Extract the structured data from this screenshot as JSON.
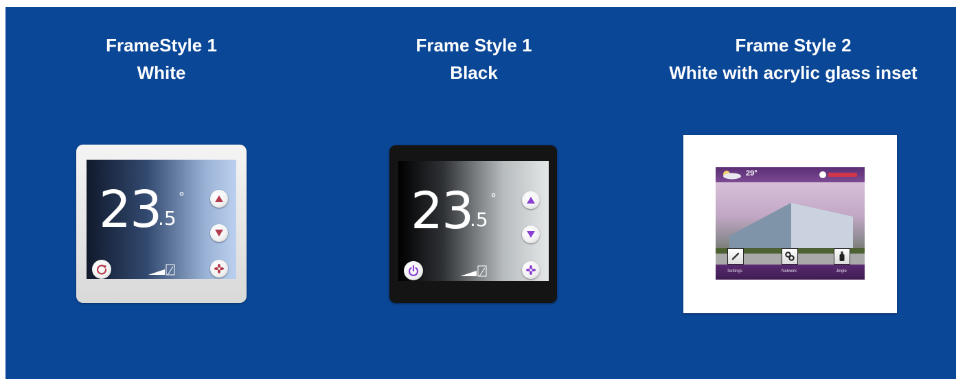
{
  "captions": [
    {
      "line1": "FrameStyle 1",
      "line2": "White"
    },
    {
      "line1": "Frame Style 1",
      "line2": "Black"
    },
    {
      "line1": "Frame Style 2",
      "line2": "White with acrylic glass inset"
    }
  ],
  "devices": [
    {
      "temp_int": "23",
      "temp_dec": ".5",
      "deg": "°"
    },
    {
      "temp_int": "23",
      "temp_dec": ".5",
      "deg": "°"
    },
    {
      "weather_temp": "29°",
      "tiles": [
        "Settings",
        "Network",
        "Jingle"
      ]
    }
  ],
  "colors": {
    "background": "#0a4797",
    "accent_white_device": "#b33c4c",
    "accent_black_device": "#8a3fd1"
  },
  "icons": [
    "arrow-up-icon",
    "arrow-down-icon",
    "fan-icon",
    "restart-icon",
    "power-icon",
    "fan-level-icon",
    "weather-cloud-icon",
    "brand-logo-icon",
    "settings-icon",
    "gears-icon",
    "bottle-icon"
  ]
}
